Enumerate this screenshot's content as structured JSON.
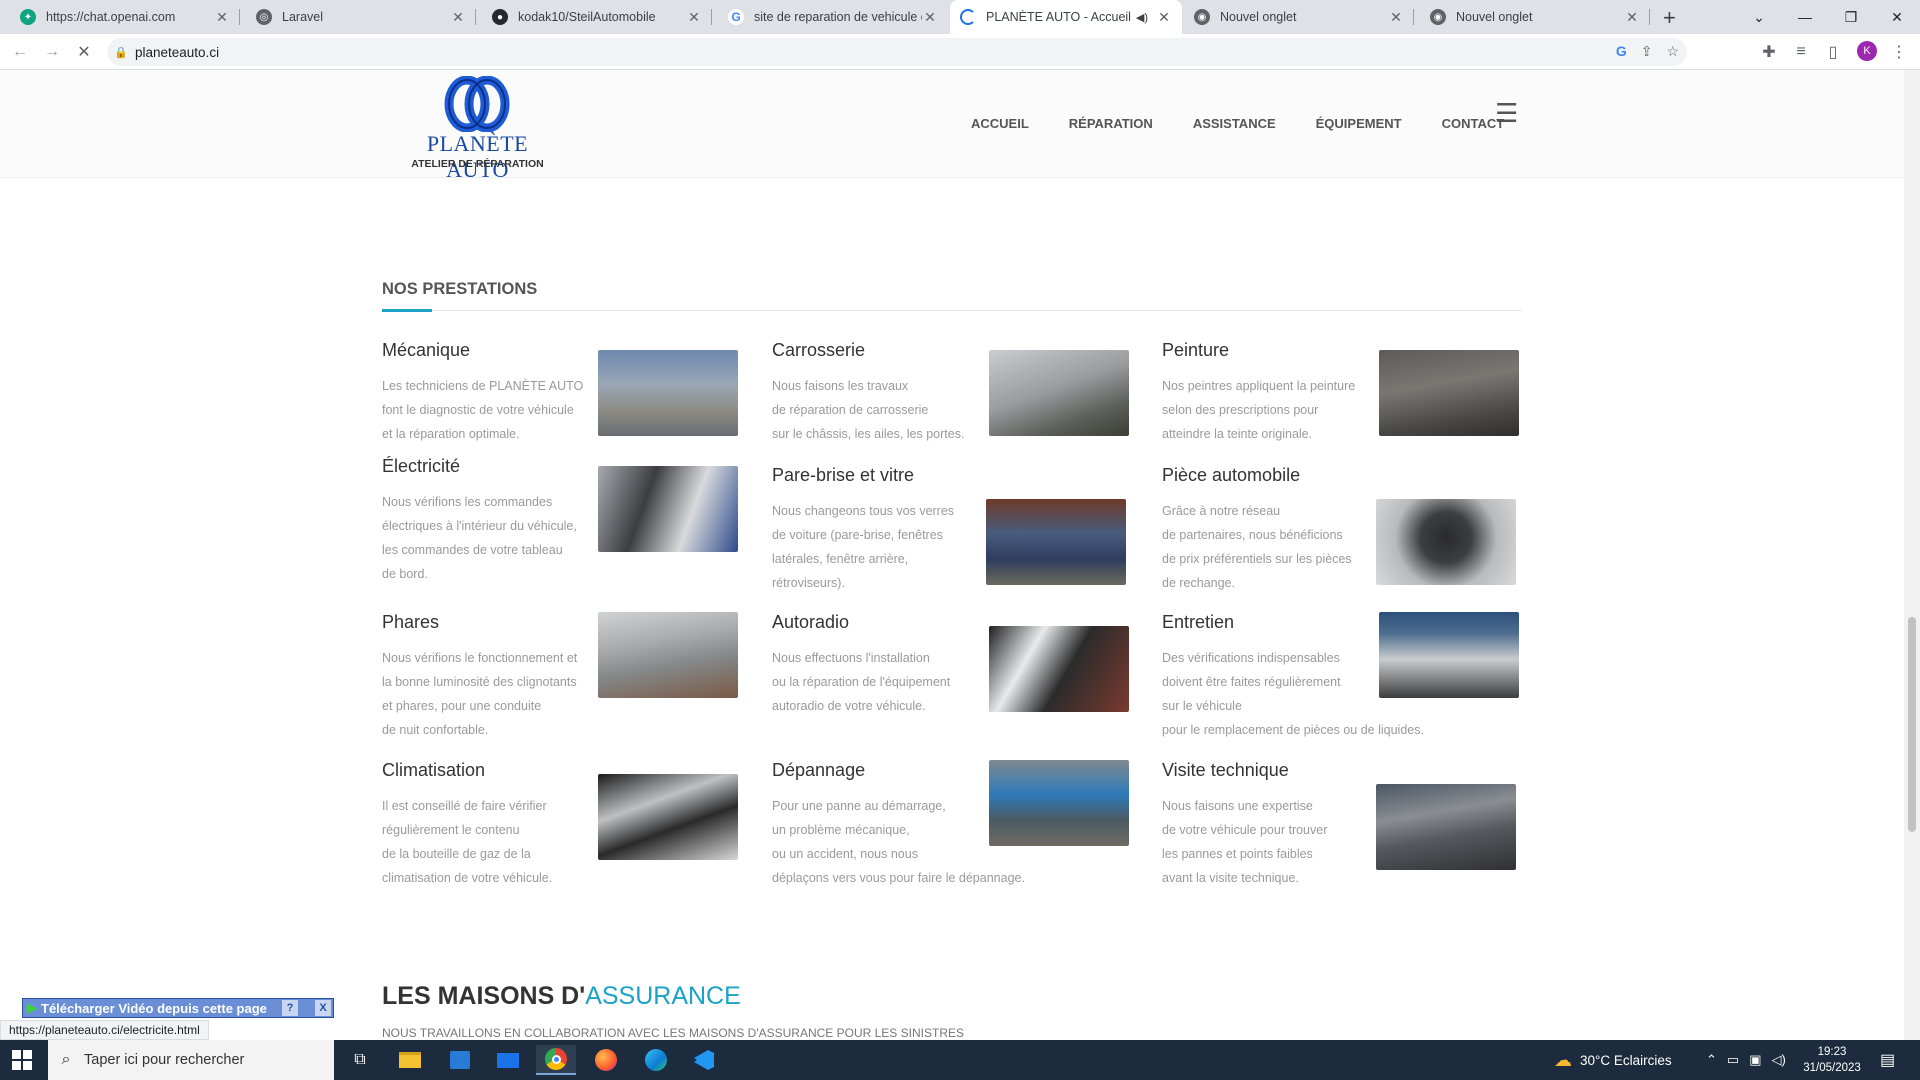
{
  "browser": {
    "tabs": [
      {
        "label": "https://chat.openai.com",
        "icon": "chatgpt-icon"
      },
      {
        "label": "Laravel",
        "icon": "globe-icon"
      },
      {
        "label": "kodak10/SteilAutomobile",
        "icon": "github-icon"
      },
      {
        "label": "site de reparation de vehicule ci",
        "icon": "google-icon"
      },
      {
        "label": "PLANÈTE AUTO - Accueil",
        "icon": "loading-icon"
      },
      {
        "label": "Nouvel onglet",
        "icon": "chrome-icon"
      },
      {
        "label": "Nouvel onglet",
        "icon": "chrome-icon"
      }
    ],
    "close_symbol": "✕",
    "newtab_symbol": "+",
    "url": "planeteauto.ci",
    "profile_initial": "K",
    "status_url": "https://planeteauto.ci/electricite.html"
  },
  "site": {
    "logo_name": "PLANÈTE AUTO",
    "logo_sub": "ATELIER DE RÉPARATION",
    "nav": [
      "ACCUEIL",
      "RÉPARATION",
      "ASSISTANCE",
      "ÉQUIPEMENT",
      "CONTACT"
    ],
    "section_title": "NOS PRESTATIONS",
    "services": [
      {
        "title": "Mécanique",
        "text": "Les techniciens de PLANÈTE AUTO\nfont le diagnostic de votre véhicule\net la réparation optimale."
      },
      {
        "title": "Carrosserie",
        "text": "Nous faisons les travaux\nde réparation de carrosserie\nsur le châssis, les ailes, les portes."
      },
      {
        "title": "Peinture",
        "text": "Nos peintres appliquent la peinture\nselon des prescriptions pour\natteindre la teinte originale."
      },
      {
        "title": "Électricité",
        "text": "Nous vérifions les commandes\nélectriques à l'intérieur du véhicule,\nles commandes de votre tableau\nde bord."
      },
      {
        "title": "Pare-brise et vitre",
        "text": "Nous changeons tous vos verres\nde voiture (pare-brise, fenêtres\nlatérales, fenêtre arrière,\nrétroviseurs)."
      },
      {
        "title": "Pièce automobile",
        "text": "Grâce à notre réseau\nde partenaires, nous bénéficions\nde prix préférentiels sur les pièces\nde rechange."
      },
      {
        "title": "Phares",
        "text": "Nous vérifions le fonctionnement et\nla bonne luminosité des clignotants\net phares, pour une conduite\nde nuit confortable."
      },
      {
        "title": "Autoradio",
        "text": "Nous effectuons l'installation\nou la réparation de l'équipement\nautoradio de votre véhicule."
      },
      {
        "title": "Entretien",
        "text": "Des vérifications indispensables\ndoivent être faites régulièrement\nsur le véhicule\npour le remplacement de pièces ou de liquides."
      },
      {
        "title": "Climatisation",
        "text": "Il est conseillé de faire vérifier\nrégulièrement le contenu\nde la bouteille de gaz de la\nclimatisation de votre véhicule."
      },
      {
        "title": "Dépannage",
        "text": "Pour une panne au démarrage,\nun problème mécanique,\nou un accident, nous nous\ndéplaçons vers vous pour faire le dépannage."
      },
      {
        "title": "Visite technique",
        "text": "Nous faisons une expertise\nde votre véhicule pour trouver\nles pannes et points faibles\navant la visite technique."
      }
    ],
    "assurance_prefix": "LES MAISONS D'",
    "assurance_highlight": "ASSURANCE",
    "assurance_sub": "NOUS TRAVAILLONS EN COLLABORATION AVEC LES MAISONS D'ASSURANCE POUR LES SINISTRES"
  },
  "extension": {
    "download_label": "Télécharger Vidéo depuis cette page",
    "help": "?",
    "close": "X"
  },
  "taskbar": {
    "search_placeholder": "Taper ici pour rechercher",
    "weather": "30°C  Eclaircies",
    "time": "19:23",
    "date": "31/05/2023",
    "accent_color": "#7aa7d8"
  }
}
